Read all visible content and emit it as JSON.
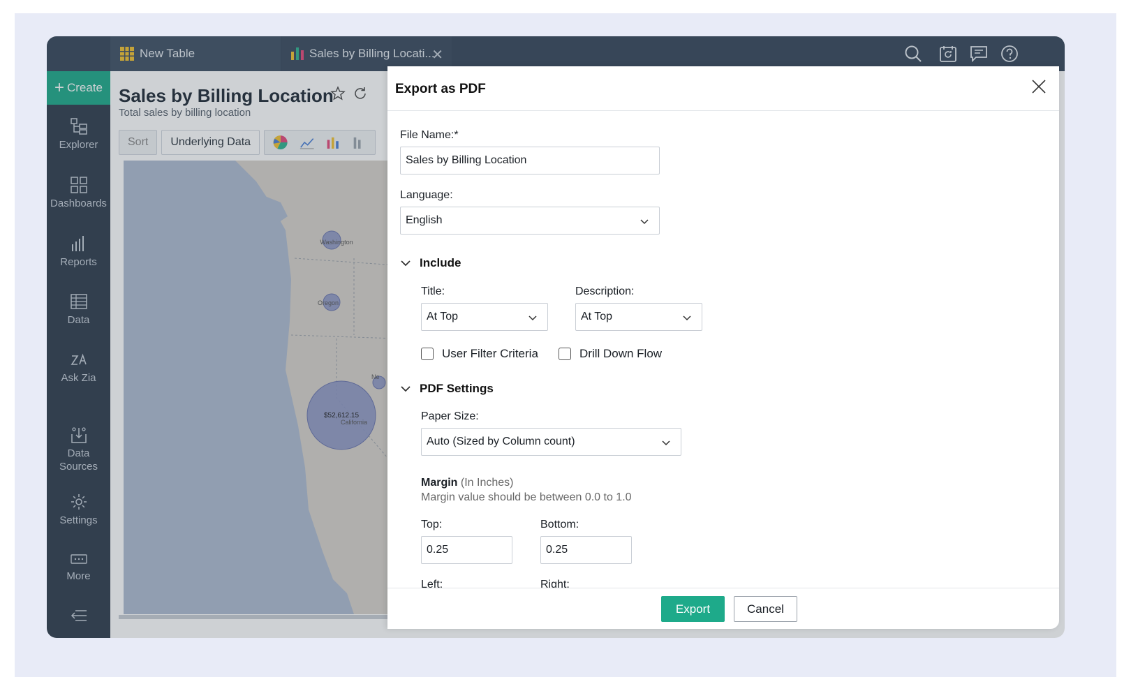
{
  "tabs": [
    {
      "label": "New Table",
      "icon": "table-grid-icon"
    },
    {
      "label": "Sales by Billing Locati...",
      "icon": "bar-chart-icon"
    }
  ],
  "topbar_icons": [
    "search-icon",
    "calendar-refresh-icon",
    "chat-icon",
    "help-icon"
  ],
  "sidebar": {
    "create_label": "Create",
    "items": [
      {
        "label": "Explorer"
      },
      {
        "label": "Dashboards"
      },
      {
        "label": "Reports"
      },
      {
        "label": "Data"
      },
      {
        "label": "Ask Zia"
      },
      {
        "label": "Data Sources"
      },
      {
        "label": "Settings"
      },
      {
        "label": "More"
      }
    ]
  },
  "report": {
    "title": "Sales by Billing Location",
    "subtitle": "Total sales by billing location",
    "toolbar": {
      "sort": "Sort",
      "underlying": "Underlying Data"
    }
  },
  "map": {
    "bubbles": [
      {
        "state": "Washington"
      },
      {
        "state": "Oregon"
      },
      {
        "state": "California",
        "value": "$52,612.15"
      },
      {
        "state": "Ne"
      }
    ]
  },
  "dialog": {
    "title": "Export as PDF",
    "file_name_label": "File Name:*",
    "file_name_value": "Sales by Billing Location",
    "language_label": "Language:",
    "language_value": "English",
    "include_label": "Include",
    "title_label": "Title:",
    "title_value": "At Top",
    "description_label": "Description:",
    "description_value": "At Top",
    "user_filter_label": "User Filter Criteria",
    "drill_down_label": "Drill Down Flow",
    "pdf_settings_label": "PDF Settings",
    "paper_size_label": "Paper Size:",
    "paper_size_value": "Auto (Sized by Column count)",
    "margin_label": "Margin",
    "margin_unit": "(In Inches)",
    "margin_hint": "Margin value should be between 0.0 to 1.0",
    "top_label": "Top:",
    "top_value": "0.25",
    "bottom_label": "Bottom:",
    "bottom_value": "0.25",
    "left_label": "Left:",
    "right_label": "Right:",
    "export_label": "Export",
    "cancel_label": "Cancel"
  },
  "colors": {
    "accent": "#1eaa8a",
    "topbar": "#36465a",
    "sidebar": "#2f3c4d"
  }
}
